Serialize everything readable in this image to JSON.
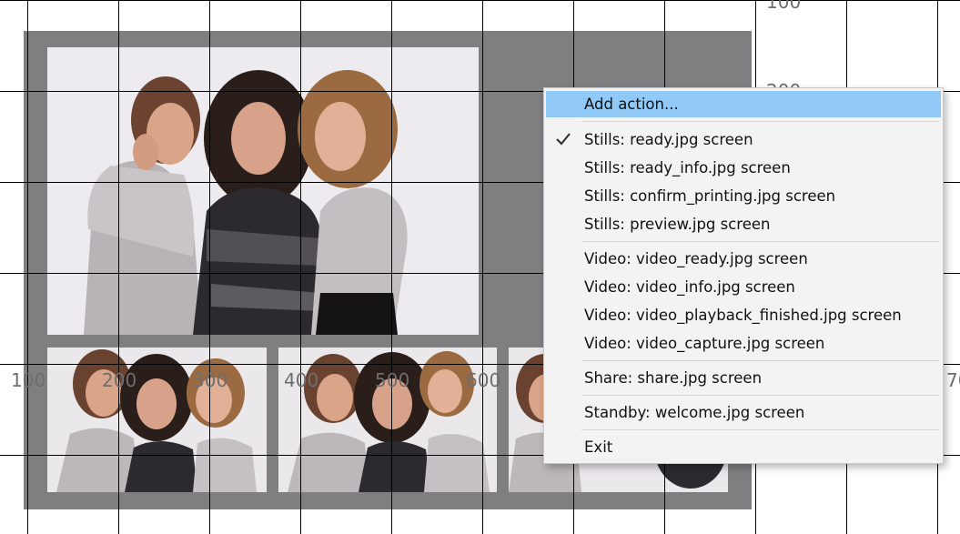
{
  "layout_preview": {
    "ruler_labels": [
      "100",
      "200",
      "300",
      "400",
      "500",
      "600",
      "100",
      "200",
      "700"
    ]
  },
  "context_menu": {
    "items": [
      {
        "label": "Add action...",
        "highlighted": true,
        "checked": false
      },
      {
        "label": "Stills: ready.jpg screen",
        "checked": true
      },
      {
        "label": "Stills: ready_info.jpg screen",
        "checked": false
      },
      {
        "label": "Stills: confirm_printing.jpg screen",
        "checked": false
      },
      {
        "label": "Stills: preview.jpg screen",
        "checked": false
      },
      {
        "label": "Video: video_ready.jpg screen",
        "checked": false
      },
      {
        "label": "Video: video_info.jpg screen",
        "checked": false
      },
      {
        "label": "Video: video_playback_finished.jpg screen",
        "checked": false
      },
      {
        "label": "Video: video_capture.jpg screen",
        "checked": false
      },
      {
        "label": "Share: share.jpg screen",
        "checked": false
      },
      {
        "label": "Standby: welcome.jpg screen",
        "checked": false
      },
      {
        "label": "Exit",
        "checked": false
      }
    ],
    "check_icon": "checkmark-icon",
    "highlight_color": "#90c8f6"
  },
  "colors": {
    "frame": "#7f7e80",
    "menu_background": "#f3f3f3",
    "ruler_text": "#6e6e6e"
  }
}
